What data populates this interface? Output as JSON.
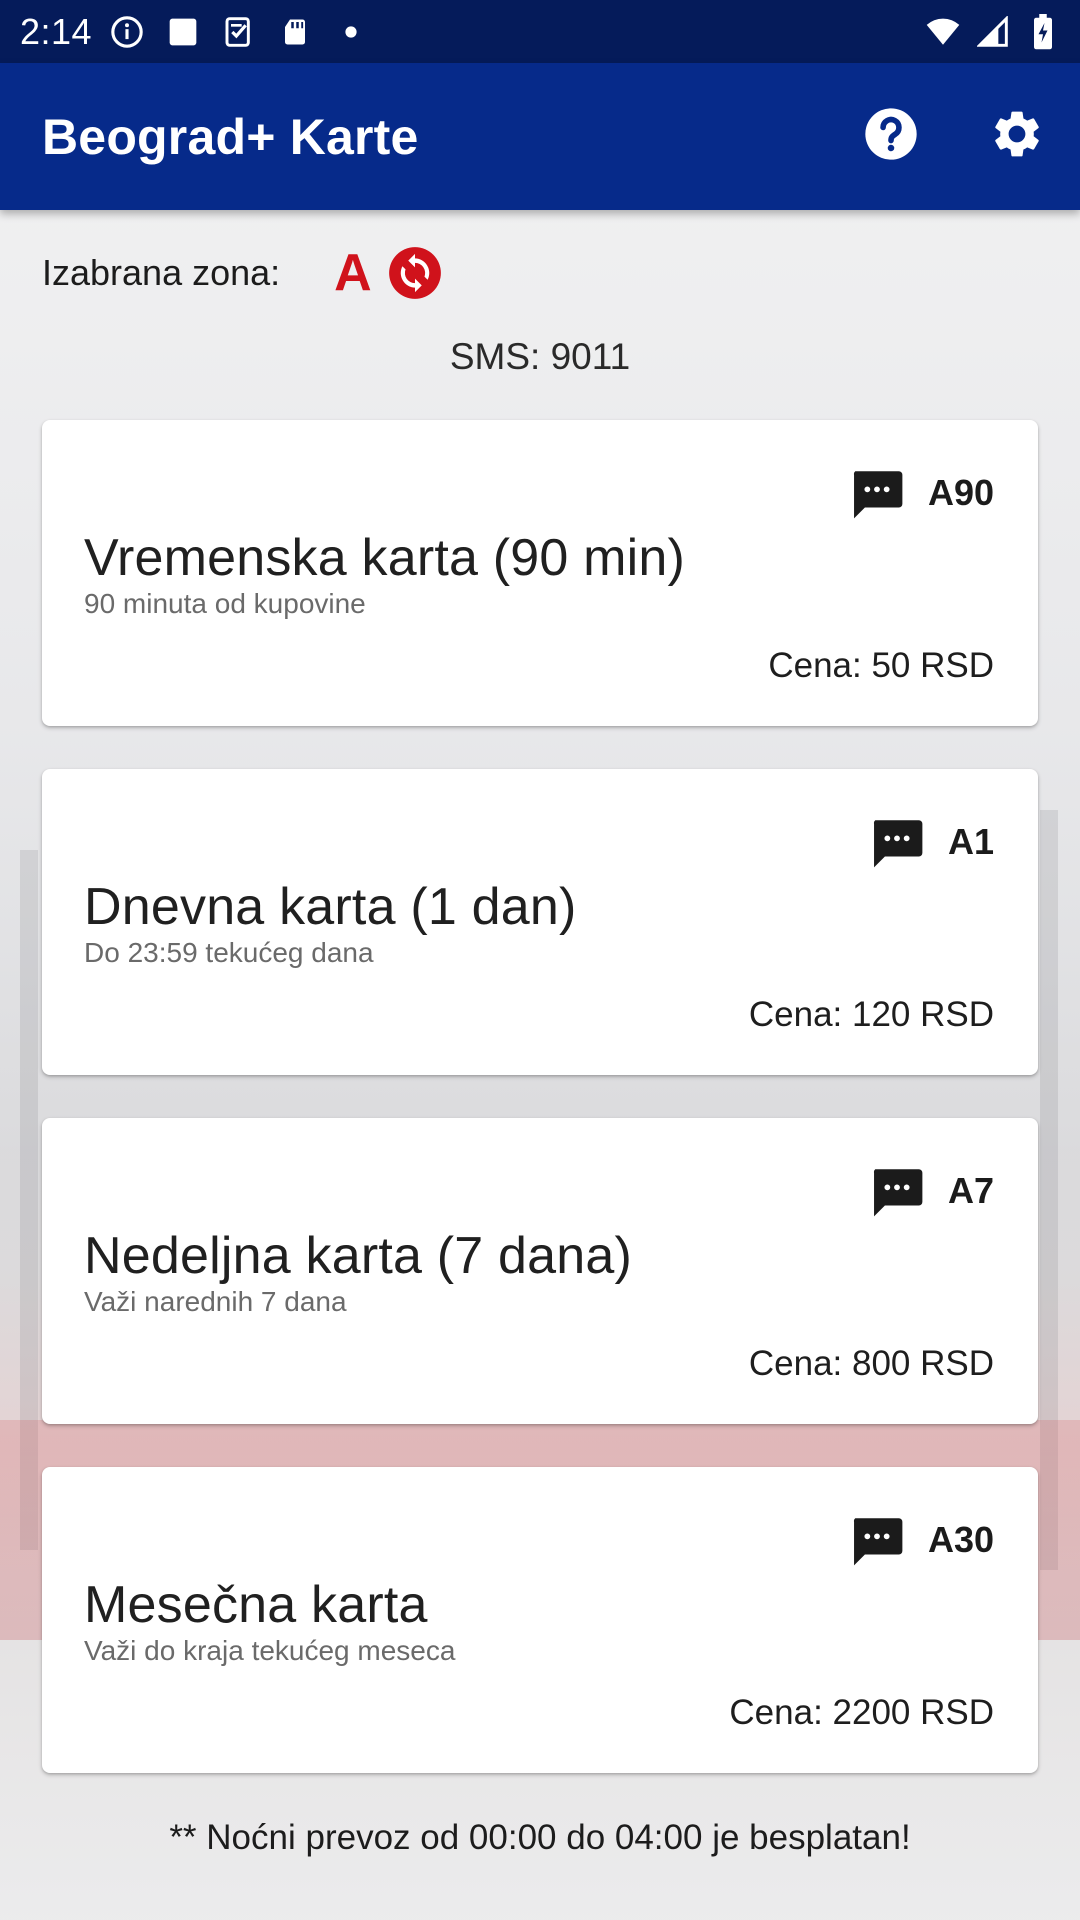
{
  "status_bar": {
    "time": "2:14",
    "left_icons": [
      "info-icon",
      "square-icon",
      "task-icon",
      "sd-card-icon",
      "dot-icon"
    ],
    "right_icons": [
      "wifi-icon",
      "cell-signal-icon",
      "battery-charging-icon"
    ]
  },
  "app_bar": {
    "title": "Beograd+ Karte",
    "actions": [
      "help-icon",
      "settings-icon"
    ]
  },
  "zone": {
    "label": "Izabrana zona:",
    "value": "A"
  },
  "sms_number": "SMS: 9011",
  "tickets": [
    {
      "code": "A90",
      "name": "Vremenska karta (90 min)",
      "description": "90 minuta od kupovine",
      "price": "Cena: 50 RSD"
    },
    {
      "code": "A1",
      "name": "Dnevna karta (1 dan)",
      "description": "Do 23:59 tekućeg dana",
      "price": "Cena: 120 RSD"
    },
    {
      "code": "A7",
      "name": "Nedeljna karta (7 dana)",
      "description": "Važi narednih 7 dana",
      "price": "Cena: 800 RSD"
    },
    {
      "code": "A30",
      "name": "Mesečna karta",
      "description": "Važi do kraja tekućeg meseca",
      "price": "Cena: 2200 RSD"
    }
  ],
  "footer_note": "** Noćni prevoz od 00:00 do 04:00 je besplatan!",
  "colors": {
    "status_bar": "#051b5a",
    "app_bar": "#062a8a",
    "zone_accent": "#d0121b",
    "card_background": "#ffffff"
  }
}
